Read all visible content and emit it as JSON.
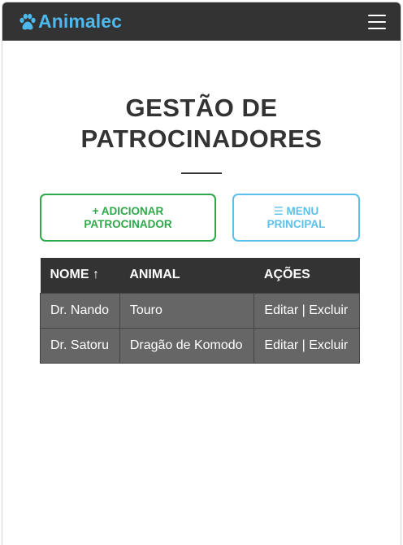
{
  "navbar": {
    "brand": "Animalec",
    "brand_icon": "paw-icon",
    "menu_icon": "hamburger-icon",
    "brand_color": "#4db8ec",
    "bg_color": "#333333"
  },
  "page": {
    "title_line1": "GESTÃO DE",
    "title_line2": "PATROCINADORES"
  },
  "buttons": {
    "add_label_line1": "+ ADICIONAR",
    "add_label_line2": "PATROCINADOR",
    "menu_label_line1": "☰ MENU",
    "menu_label_line2": "PRINCIPAL",
    "add_color": "#2ea84a",
    "menu_color": "#5bc0eb"
  },
  "table": {
    "headers": [
      "NOME ↑",
      "ANIMAL",
      "AÇÕES"
    ],
    "rows": [
      {
        "nome": "Dr. Nando",
        "animal": "Touro",
        "edit": "Editar",
        "sep": " | ",
        "delete": "Excluir"
      },
      {
        "nome": "Dr. Satoru",
        "animal": "Dragão de Komodo",
        "edit": "Editar",
        "sep": " | ",
        "delete": "Excluir"
      }
    ]
  }
}
